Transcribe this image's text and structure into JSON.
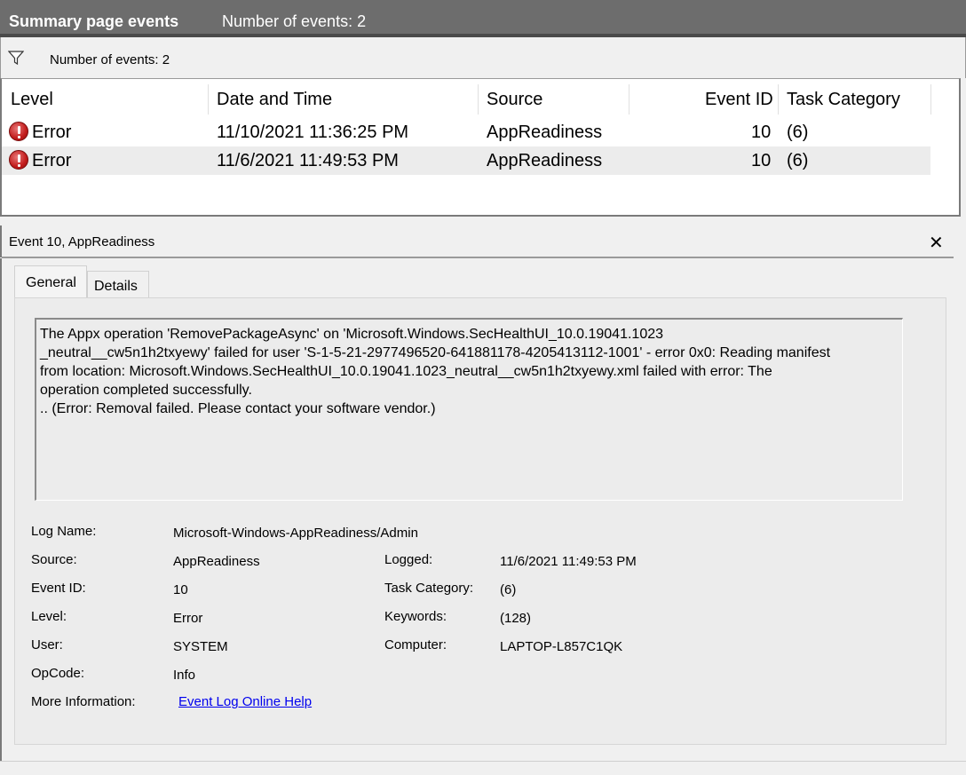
{
  "title_bar": {
    "title": "Summary page events",
    "event_count": "Number of events: 2"
  },
  "filter_bar": {
    "icon": "filter-icon",
    "text": "Number of events: 2"
  },
  "events_table": {
    "columns": [
      "Level",
      "Date and Time",
      "Source",
      "Event ID",
      "Task Category"
    ],
    "rows": [
      {
        "level": "Error",
        "datetime": "11/10/2021 11:36:25 PM",
        "source": "AppReadiness",
        "event_id": "10",
        "task_category": "(6)"
      },
      {
        "level": "Error",
        "datetime": "11/6/2021 11:49:53 PM",
        "source": "AppReadiness",
        "event_id": "10",
        "task_category": "(6)"
      }
    ]
  },
  "detail_pane": {
    "title": "Event 10, AppReadiness",
    "close_glyph": "✕",
    "tabs": [
      "General",
      "Details"
    ],
    "message_lines": [
      "The Appx operation 'RemovePackageAsync' on 'Microsoft.Windows.SecHealthUI_10.0.19041.1023",
      "_neutral__cw5n1h2txyewy' failed for user 'S-1-5-21-2977496520-641881178-4205413112-1001' - error 0x0: Reading manifest",
      "from location: Microsoft.Windows.SecHealthUI_10.0.19041.1023_neutral__cw5n1h2txyewy.xml failed with error: The",
      "operation completed successfully.",
      ".. (Error: Removal failed. Please contact your software vendor.)"
    ],
    "fields": {
      "log_name_label": "Log Name:",
      "log_name": "Microsoft-Windows-AppReadiness/Admin",
      "source_label": "Source:",
      "source": "AppReadiness",
      "logged_label": "Logged:",
      "logged": "11/6/2021 11:49:53 PM",
      "event_id_label": "Event ID:",
      "event_id": "10",
      "task_category_label": "Task Category:",
      "task_category": "(6)",
      "level_label": "Level:",
      "level": "Error",
      "keywords_label": "Keywords:",
      "keywords": "(128)",
      "user_label": "User:",
      "user": "SYSTEM",
      "computer_label": "Computer:",
      "computer": "LAPTOP-L857C1QK",
      "opcode_label": "OpCode:",
      "opcode": "Info",
      "more_info_label": "More Information:",
      "more_info_link": "Event Log Online Help"
    }
  }
}
